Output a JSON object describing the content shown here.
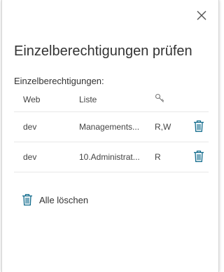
{
  "panel": {
    "title": "Einzelberechtigungen prüfen",
    "section_label": "Einzelberechtigungen:",
    "accent_color": "#0f6a8b"
  },
  "table": {
    "columns": {
      "web": "Web",
      "liste": "Liste",
      "permissions_icon": "key-icon"
    },
    "rows": [
      {
        "web": "dev",
        "liste": "Managements...",
        "permissions": "R,W"
      },
      {
        "web": "dev",
        "liste": "10.Administrat...",
        "permissions": "R"
      }
    ]
  },
  "actions": {
    "clear_all_label": "Alle löschen"
  }
}
